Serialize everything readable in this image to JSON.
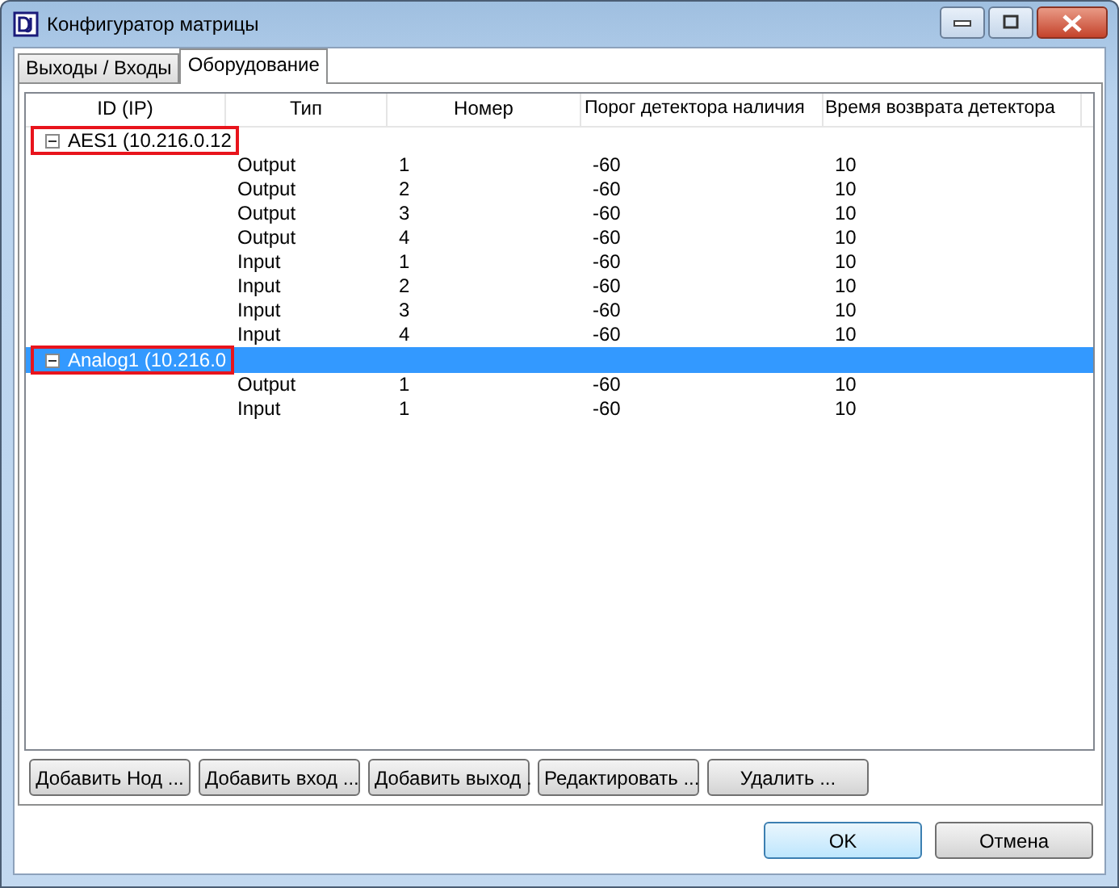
{
  "window": {
    "title": "Конфигуратор матрицы"
  },
  "tabs": [
    {
      "label": "Выходы / Входы",
      "selected": false
    },
    {
      "label": "Оборудование",
      "selected": true
    }
  ],
  "table": {
    "columns": [
      "ID (IP)",
      "Тип",
      "Номер",
      "Порог детектора наличия",
      "Время возврата детектора"
    ],
    "nodes": [
      {
        "label": "AES1 (10.216.0.12",
        "expanded": true,
        "selected": false,
        "highlighted": true,
        "children": [
          {
            "type": "Output",
            "number": "1",
            "threshold": "-60",
            "return_time": "10"
          },
          {
            "type": "Output",
            "number": "2",
            "threshold": "-60",
            "return_time": "10"
          },
          {
            "type": "Output",
            "number": "3",
            "threshold": "-60",
            "return_time": "10"
          },
          {
            "type": "Output",
            "number": "4",
            "threshold": "-60",
            "return_time": "10"
          },
          {
            "type": "Input",
            "number": "1",
            "threshold": "-60",
            "return_time": "10"
          },
          {
            "type": "Input",
            "number": "2",
            "threshold": "-60",
            "return_time": "10"
          },
          {
            "type": "Input",
            "number": "3",
            "threshold": "-60",
            "return_time": "10"
          },
          {
            "type": "Input",
            "number": "4",
            "threshold": "-60",
            "return_time": "10"
          }
        ]
      },
      {
        "label": "Analog1 (10.216.0",
        "expanded": true,
        "selected": true,
        "highlighted": true,
        "children": [
          {
            "type": "Output",
            "number": "1",
            "threshold": "-60",
            "return_time": "10"
          },
          {
            "type": "Input",
            "number": "1",
            "threshold": "-60",
            "return_time": "10"
          }
        ]
      }
    ]
  },
  "buttons": [
    "Добавить Нод ...",
    "Добавить вход ...",
    "Добавить выход .",
    "Редактировать ...",
    "Удалить ..."
  ],
  "dialog_buttons": [
    {
      "label": "OK",
      "default": true
    },
    {
      "label": "Отмена",
      "default": false
    }
  ]
}
